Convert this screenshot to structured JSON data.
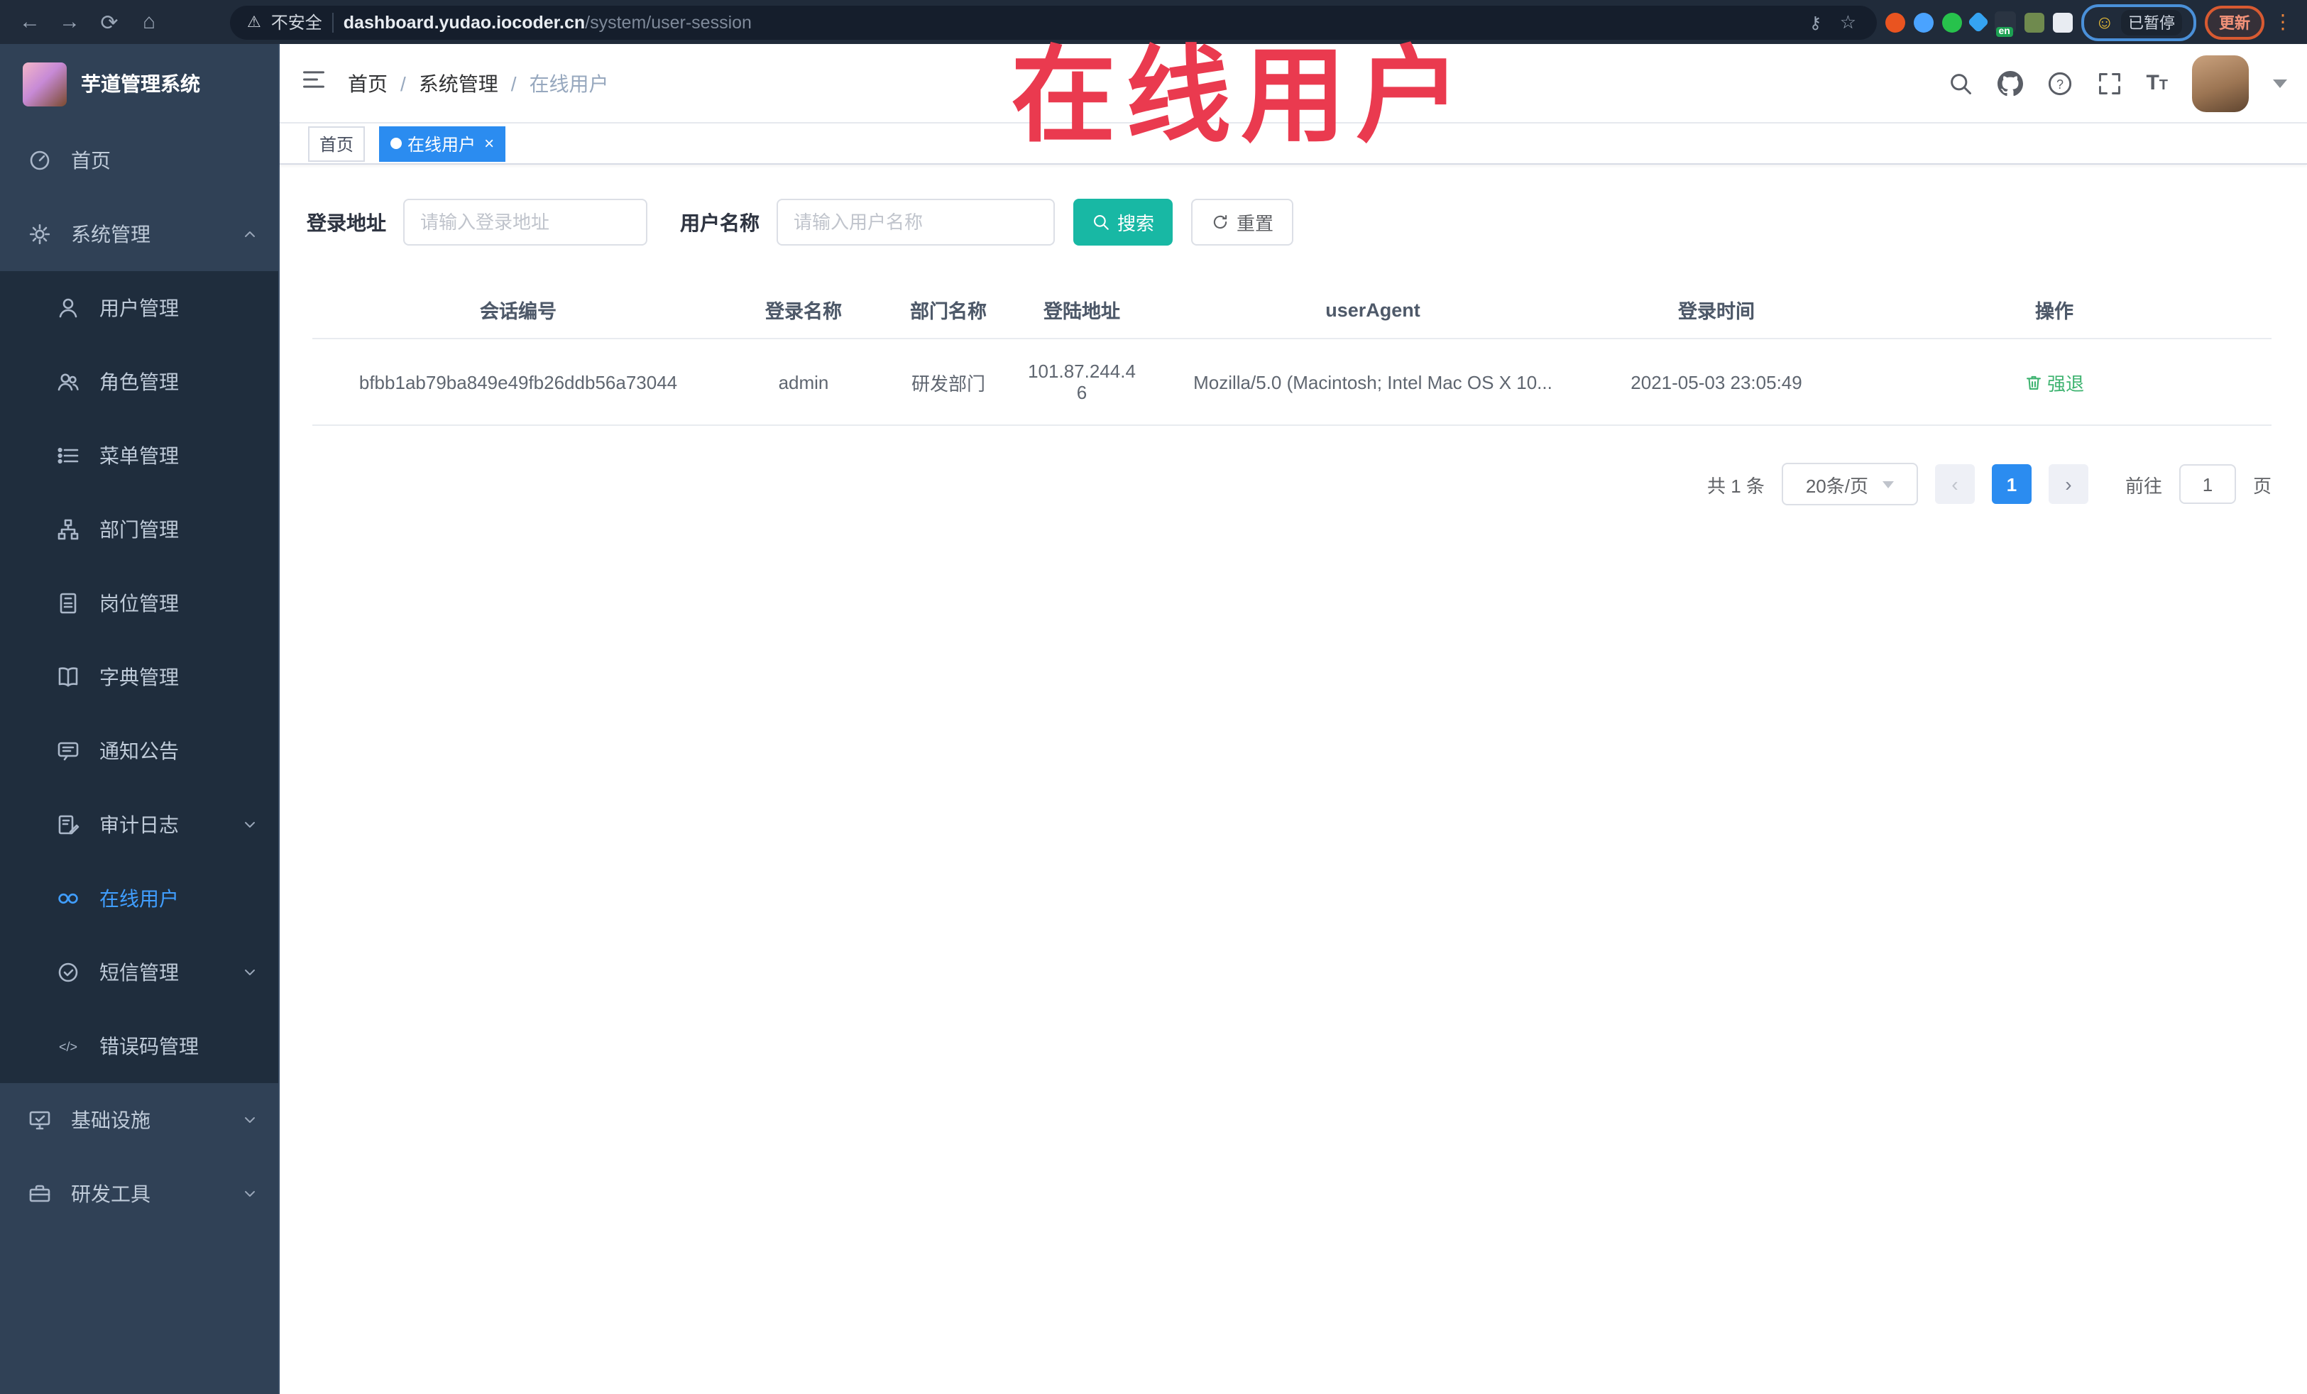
{
  "browser": {
    "security_label": "不安全",
    "url_domain": "dashboard.yudao.iocoder.cn",
    "url_path": "/system/user-session",
    "paused_label": "已暂停",
    "update_label": "更新",
    "extension_en_badge": "en"
  },
  "annotation": {
    "text": "在线用户",
    "color": "#ea3a4f"
  },
  "sidebar": {
    "title": "芋道管理系统",
    "items": [
      {
        "label": "首页",
        "icon": "dashboard-icon"
      },
      {
        "label": "系统管理",
        "icon": "gear-icon",
        "state": "expanded"
      },
      {
        "label": "用户管理",
        "icon": "user-icon"
      },
      {
        "label": "角色管理",
        "icon": "users-icon"
      },
      {
        "label": "菜单管理",
        "icon": "list-icon"
      },
      {
        "label": "部门管理",
        "icon": "tree-icon"
      },
      {
        "label": "岗位管理",
        "icon": "badge-icon"
      },
      {
        "label": "字典管理",
        "icon": "book-icon"
      },
      {
        "label": "通知公告",
        "icon": "message-icon"
      },
      {
        "label": "审计日志",
        "icon": "clipboard-icon",
        "state": "collapsed"
      },
      {
        "label": "在线用户",
        "icon": "online-icon",
        "state": "active"
      },
      {
        "label": "短信管理",
        "icon": "check-circle-icon",
        "state": "collapsed"
      },
      {
        "label": "错误码管理",
        "icon": "code-icon"
      },
      {
        "label": "基础设施",
        "icon": "monitor-icon",
        "state": "collapsed"
      },
      {
        "label": "研发工具",
        "icon": "toolbox-icon",
        "state": "collapsed"
      }
    ]
  },
  "header": {
    "breadcrumb": [
      "首页",
      "系统管理",
      "在线用户"
    ]
  },
  "tags": [
    {
      "label": "首页",
      "active": false
    },
    {
      "label": "在线用户",
      "active": true
    }
  ],
  "filters": {
    "address_label": "登录地址",
    "address_placeholder": "请输入登录地址",
    "username_label": "用户名称",
    "username_placeholder": "请输入用户名称",
    "search_label": "搜索",
    "reset_label": "重置"
  },
  "table": {
    "headers": [
      "会话编号",
      "登录名称",
      "部门名称",
      "登陆地址",
      "userAgent",
      "登录时间",
      "操作"
    ],
    "rows": [
      {
        "session": "bfbb1ab79ba849e49fb26ddb56a73044",
        "username": "admin",
        "dept": "研发部门",
        "ip": "101.87.244.46",
        "agent": "Mozilla/5.0 (Macintosh; Intel Mac OS X 10...",
        "time": "2021-05-03 23:05:49",
        "action": "强退"
      }
    ]
  },
  "pagination": {
    "total": "共 1 条",
    "size": "20条/页",
    "page": "1",
    "goto_label": "前往",
    "goto_value": "1",
    "unit": "页"
  },
  "glyphs": {
    "back": "←",
    "forward": "→",
    "reload": "⟳",
    "home": "⌂",
    "warning": "⚠",
    "star": "☆",
    "key": "⚷",
    "smiley": "☺",
    "dots": "⋮",
    "slash": "/",
    "close": "×",
    "prev": "‹",
    "next": "›",
    "code": "</>",
    "question": "?"
  },
  "colors": {
    "accent": "#2b8cf0",
    "sidebar_bg": "#304156",
    "submenu_bg": "#1f2d3d",
    "search_button": "#18b8a4",
    "kick_link": "#3eb370",
    "annotation": "#ea3a4f",
    "active_menu": "#409eff"
  }
}
